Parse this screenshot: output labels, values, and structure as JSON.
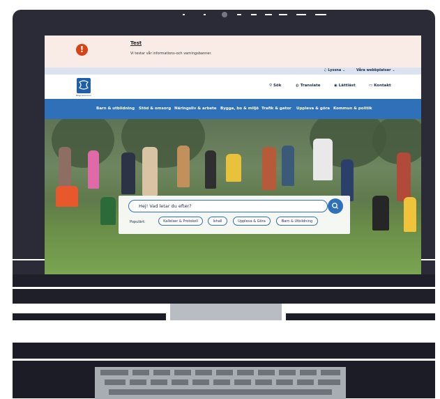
{
  "banner": {
    "icon": "exclamation-icon",
    "icon_glyph": "!",
    "title": "Test",
    "text": "Vi testar vår informations-och varningsbanner."
  },
  "utility_bar": {
    "listen": "Lyssna",
    "websites": "Våra webbplatser"
  },
  "header": {
    "logo_text": "Eksjö kommun",
    "search": "Sök",
    "translate": "Translate",
    "easy_read": "Lättläst",
    "contact": "Kontakt"
  },
  "nav": {
    "items": [
      "Barn & utbildning",
      "Stöd & omsorg",
      "Näringsliv & arbete",
      "Bygga, bo & miljö",
      "Trafik & gator",
      "Uppleva & göra",
      "Kommun & politik"
    ]
  },
  "search": {
    "placeholder": "Hej! Vad letar du efter?",
    "popular_label": "Populärt:",
    "chips": [
      "Kallelser & Protokoll",
      "Ishall",
      "Uppleva & Göra",
      "Barn & Utbildning"
    ]
  },
  "colors": {
    "brand_blue": "#2f71b8",
    "alert": "#d84315",
    "banner_bg": "#f9ece7"
  }
}
